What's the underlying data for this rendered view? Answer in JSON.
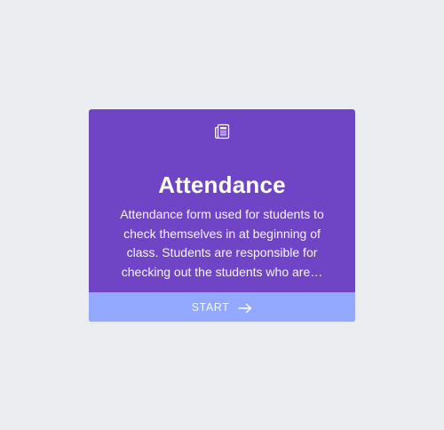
{
  "card": {
    "title": "Attendance",
    "description_lines": [
      "Attendance form used for students to",
      "check themselves in at beginning of",
      "class. Students are responsible for",
      "checking out the students who are…"
    ],
    "icon": "newspaper-icon",
    "start_label": "START",
    "start_icon": "arrow-right-icon"
  },
  "colors": {
    "page_background": "#ecedf1",
    "card_background": "#6f45c6",
    "start_bar_background": "#93a8ff"
  }
}
